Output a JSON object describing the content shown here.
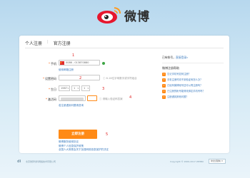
{
  "brand": {
    "logo_text": "微博",
    "footer_logo": "di"
  },
  "tabs": [
    {
      "label": "个人注册"
    },
    {
      "label": "官方注册"
    }
  ],
  "form": {
    "phone": {
      "label": "手机",
      "country": "+86",
      "value": "0086 - 013870880",
      "marker": "1"
    },
    "password": {
      "label": "设置密码",
      "placeholder": "",
      "hint": "6-16位字母数字或字符组合",
      "marker": "2"
    },
    "birthday": {
      "label": "生日",
      "year": "1987",
      "month": "1",
      "day": "1",
      "marker": "3"
    },
    "code": {
      "label": "激活码",
      "hint": "请输入验证码答案",
      "marker": "4",
      "refresh_link": "换一张"
    },
    "phone_sub_link": "使用邮箱注册",
    "code_sub_link": "若注册遇到问题请咨询",
    "submit_label": "立即注册",
    "submit_marker": "5",
    "links": [
      "微博服务使用协议",
      "微博个人信息保护政策",
      "全国人大常委会关于加强网络信息保护的决定"
    ]
  },
  "sidebar": {
    "have_account_prefix": "已有帐号，",
    "login_link": "直接登录»",
    "faq_title": "微博注册帮助",
    "faq": [
      "忘记手机号如何注册？",
      "手机注册时收不到验证码怎么办？",
      "已经有微博帐号还可以再注册吗？",
      "已注册的帐号能修改绑定手机号吗？",
      "注册遇到其他问题？"
    ]
  },
  "footer": {
    "left_text": "北京微梦创科网络技术有限公司",
    "right_text": "Copyright © 2009-2017 WEIBO",
    "language": "中文(简体)"
  },
  "colors": {
    "accent": "#ff8a16",
    "link": "#3b7bbf",
    "marker": "#e02020",
    "background_top": "#b7d8ee"
  }
}
